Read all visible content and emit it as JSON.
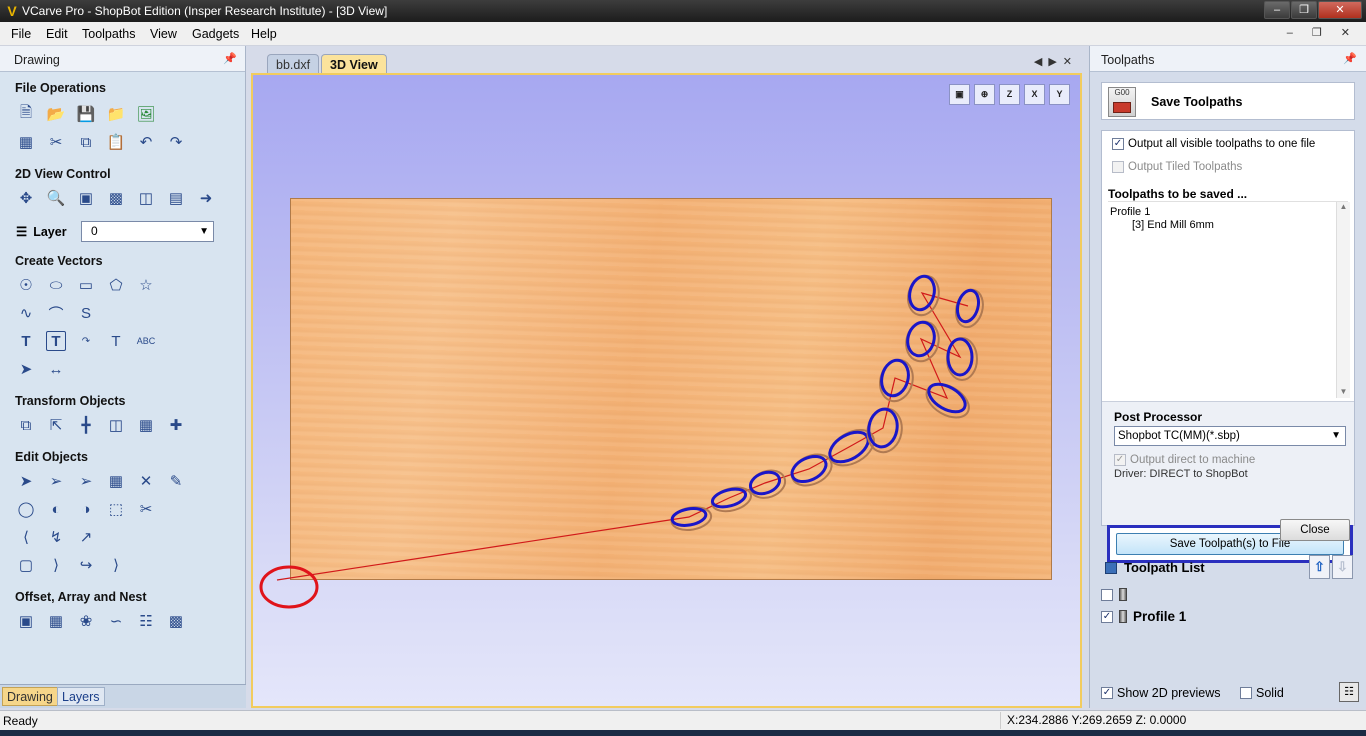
{
  "window": {
    "title": "VCarve Pro - ShopBot Edition (Insper Research Institute) - [3D View]",
    "controls": [
      "minimize",
      "restore",
      "close"
    ]
  },
  "menu": [
    "File",
    "Edit",
    "Toolpaths",
    "View",
    "Gadgets",
    "Help"
  ],
  "left_panel": {
    "title": "Drawing",
    "sections": {
      "file_operations": "File Operations",
      "view_control": "2D View Control",
      "create_vectors": "Create Vectors",
      "transform_objects": "Transform Objects",
      "edit_objects": "Edit Objects",
      "offset_array_nest": "Offset, Array and Nest"
    },
    "layer": {
      "label": "Layer",
      "value": "0"
    },
    "tabs": [
      "Drawing",
      "Layers"
    ]
  },
  "document": {
    "tabs": [
      "bb.dxf",
      "3D View"
    ],
    "active_tab": "3D View",
    "view_buttons": [
      "fit-view",
      "iso-view",
      "z-view",
      "x-view",
      "y-view"
    ],
    "colors": {
      "toolpath": "#1a16c8",
      "rapid": "#d11a1a",
      "wood": "#f5b67a",
      "highlight_circle": "#e0141a"
    }
  },
  "right_panel": {
    "title": "Toolpaths",
    "header": "Save Toolpaths",
    "output_all_visible": "Output all visible toolpaths to one file",
    "output_tiled": "Output Tiled Toolpaths",
    "toolpaths_to_save_title": "Toolpaths to be saved ...",
    "toolpath_name": "Profile 1",
    "toolpath_tool": "[3] End Mill 6mm",
    "post_processor_title": "Post Processor",
    "post_processor_value": "Shopbot TC(MM)(*.sbp)",
    "output_direct": "Output direct to machine",
    "driver_text": "Driver: DIRECT to ShopBot",
    "save_button": "Save Toolpath(s) to File",
    "close_button": "Close",
    "toolpath_list_title": "Toolpath List",
    "toolpath_list_items": [
      "",
      "Profile 1"
    ],
    "show_2d_previews": "Show 2D previews",
    "solid": "Solid"
  },
  "status": {
    "ready": "Ready",
    "coords": "X:234.2886 Y:269.2659 Z:  0.0000"
  }
}
